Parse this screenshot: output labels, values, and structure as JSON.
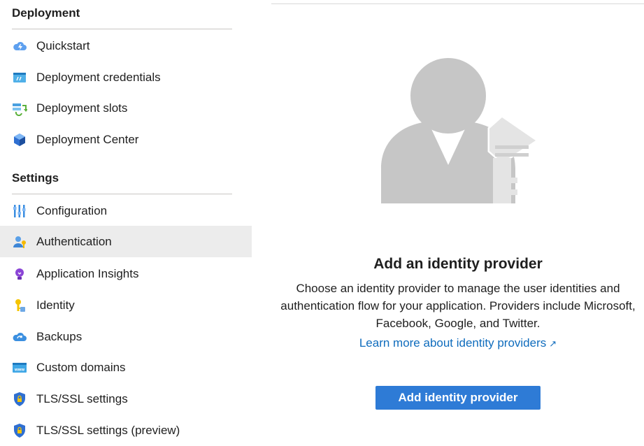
{
  "sidebar": {
    "sections": [
      {
        "title": "Deployment",
        "items": [
          {
            "label": "Quickstart",
            "icon": "cloud-lightning-icon"
          },
          {
            "label": "Deployment credentials",
            "icon": "credentials-icon"
          },
          {
            "label": "Deployment slots",
            "icon": "slots-icon"
          },
          {
            "label": "Deployment Center",
            "icon": "cube-icon"
          }
        ]
      },
      {
        "title": "Settings",
        "items": [
          {
            "label": "Configuration",
            "icon": "sliders-icon"
          },
          {
            "label": "Authentication",
            "icon": "user-key-icon",
            "selected": true
          },
          {
            "label": "Application Insights",
            "icon": "lightbulb-icon"
          },
          {
            "label": "Identity",
            "icon": "identity-key-icon"
          },
          {
            "label": "Backups",
            "icon": "cloud-backup-icon"
          },
          {
            "label": "Custom domains",
            "icon": "www-icon"
          },
          {
            "label": "TLS/SSL settings",
            "icon": "shield-lock-icon"
          },
          {
            "label": "TLS/SSL settings (preview)",
            "icon": "shield-lock-icon"
          }
        ]
      }
    ]
  },
  "main": {
    "illustration": "user-with-key-illustration",
    "heading": "Add an identity provider",
    "description": "Choose an identity provider to manage the user identities and authentication flow for your application. Providers include Microsoft, Facebook, Google, and Twitter.",
    "learn_more_link": "Learn more about identity providers",
    "add_button": "Add identity provider"
  },
  "colors": {
    "accent": "#2e7bd6",
    "link": "#0f6cbd",
    "selected_bg": "#ececec"
  }
}
